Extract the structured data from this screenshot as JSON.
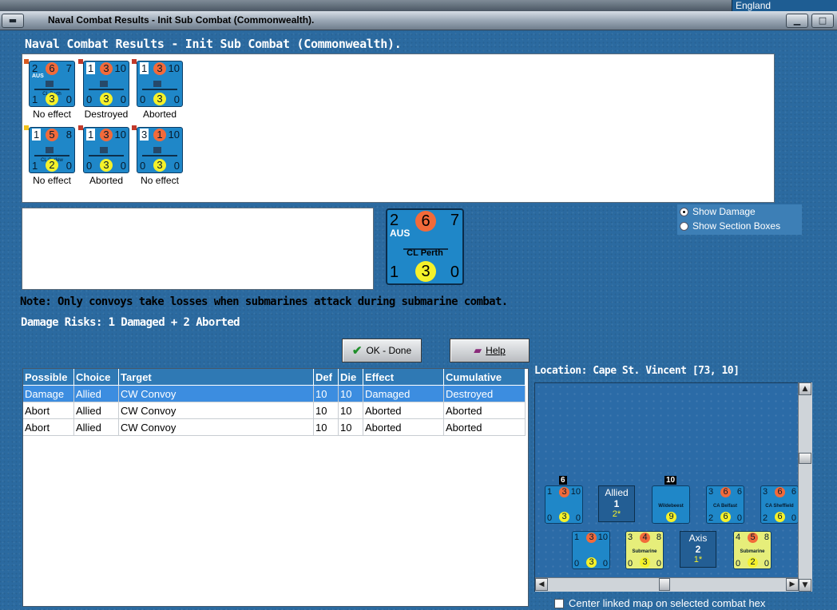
{
  "window": {
    "titlebar_text": "Naval Combat Results - Init Sub Combat (Commonwealth).",
    "background_tab": "England",
    "heading": "Naval Combat Results - Init Sub Combat (Commonwealth)."
  },
  "units": [
    {
      "tl": "2",
      "red": "6",
      "tr": "7",
      "bl": "1",
      "yel": "3",
      "br": "0",
      "nat": "AUS",
      "name": "CL Perth",
      "caption": "No effect"
    },
    {
      "tl": "1",
      "red": "3",
      "tr": "10",
      "bl": "0",
      "yel": "3",
      "br": "0",
      "nat": "",
      "name": "",
      "caption": "Destroyed"
    },
    {
      "tl": "1",
      "red": "3",
      "tr": "10",
      "bl": "0",
      "yel": "3",
      "br": "0",
      "nat": "",
      "name": "",
      "caption": "Aborted"
    },
    {
      "tl": "1",
      "red": "5",
      "tr": "8",
      "bl": "1",
      "yel": "2",
      "br": "0",
      "nat": "",
      "name": "CL Curlew",
      "caption": "No effect"
    },
    {
      "tl": "1",
      "red": "3",
      "tr": "10",
      "bl": "0",
      "yel": "3",
      "br": "0",
      "nat": "",
      "name": "",
      "caption": "Aborted"
    },
    {
      "tl": "3",
      "red": "1",
      "tr": "10",
      "bl": "0",
      "yel": "3",
      "br": "0",
      "nat": "",
      "name": "",
      "caption": "No effect"
    }
  ],
  "selected_unit": {
    "tl": "2",
    "red": "6",
    "tr": "7",
    "bl": "1",
    "yel": "3",
    "br": "0",
    "nat": "AUS",
    "name": "CL Perth"
  },
  "display_options": {
    "show_damage": "Show Damage",
    "show_section_boxes": "Show Section Boxes",
    "selected": "show_damage"
  },
  "note": "Note: Only convoys take losses when submarines attack during submarine combat.",
  "damage_risks": "Damage Risks: 1 Damaged + 2 Aborted",
  "buttons": {
    "ok": "OK - Done",
    "help": "Help"
  },
  "table": {
    "columns": [
      "Possible",
      "Choice",
      "Target",
      "Def",
      "Die",
      "Effect",
      "Cumulative"
    ],
    "rows": [
      [
        "Damage",
        "Allied",
        "CW Convoy",
        "10",
        "10",
        "Damaged",
        "Destroyed"
      ],
      [
        "Abort",
        "Allied",
        "CW Convoy",
        "10",
        "10",
        "Aborted",
        "Aborted"
      ],
      [
        "Abort",
        "Allied",
        "CW Convoy",
        "10",
        "10",
        "Aborted",
        "Aborted"
      ]
    ],
    "selected_row": 0
  },
  "location": "Location:  Cape St. Vincent [73, 10]",
  "map": {
    "allied_label": "Allied",
    "allied_count": "1",
    "allied_sub": "2*",
    "axis_label": "Axis",
    "axis_count": "2",
    "axis_sub": "1*",
    "stack_tag_1": "6",
    "stack_tag_2": "10",
    "allied_units": [
      {
        "tl": "1",
        "red": "3",
        "tr": "10",
        "bl": "0",
        "yel": "3",
        "br": "0",
        "name": ""
      },
      {
        "tl": "",
        "red": "",
        "tr": "",
        "bl": "",
        "yel": "9",
        "br": "",
        "name": "Wildebeest"
      },
      {
        "tl": "3",
        "red": "6",
        "tr": "6",
        "bl": "2",
        "yel": "6",
        "br": "0",
        "name": "CA Belfast"
      },
      {
        "tl": "3",
        "red": "6",
        "tr": "6",
        "bl": "2",
        "yel": "6",
        "br": "0",
        "name": "CA Sheffield"
      }
    ],
    "axis_units": [
      {
        "tl": "1",
        "red": "3",
        "tr": "10",
        "bl": "0",
        "yel": "3",
        "br": "0",
        "name": ""
      },
      {
        "tl": "3",
        "red": "4",
        "tr": "8",
        "bl": "0",
        "yel": "3",
        "br": "0",
        "name": "Submarine"
      },
      {
        "tl": "4",
        "red": "5",
        "tr": "8",
        "bl": "0",
        "yel": "2",
        "br": "0",
        "name": "Submarine"
      }
    ]
  },
  "center_map_label": "Center linked map on selected combat hex",
  "colors": {
    "accent_blue": "#1f87c8",
    "panel_blue": "#2b6aa0",
    "select_blue": "#3c8de0",
    "header_blue": "#2f79b4",
    "sub_yellow": "#e6ee7a"
  }
}
